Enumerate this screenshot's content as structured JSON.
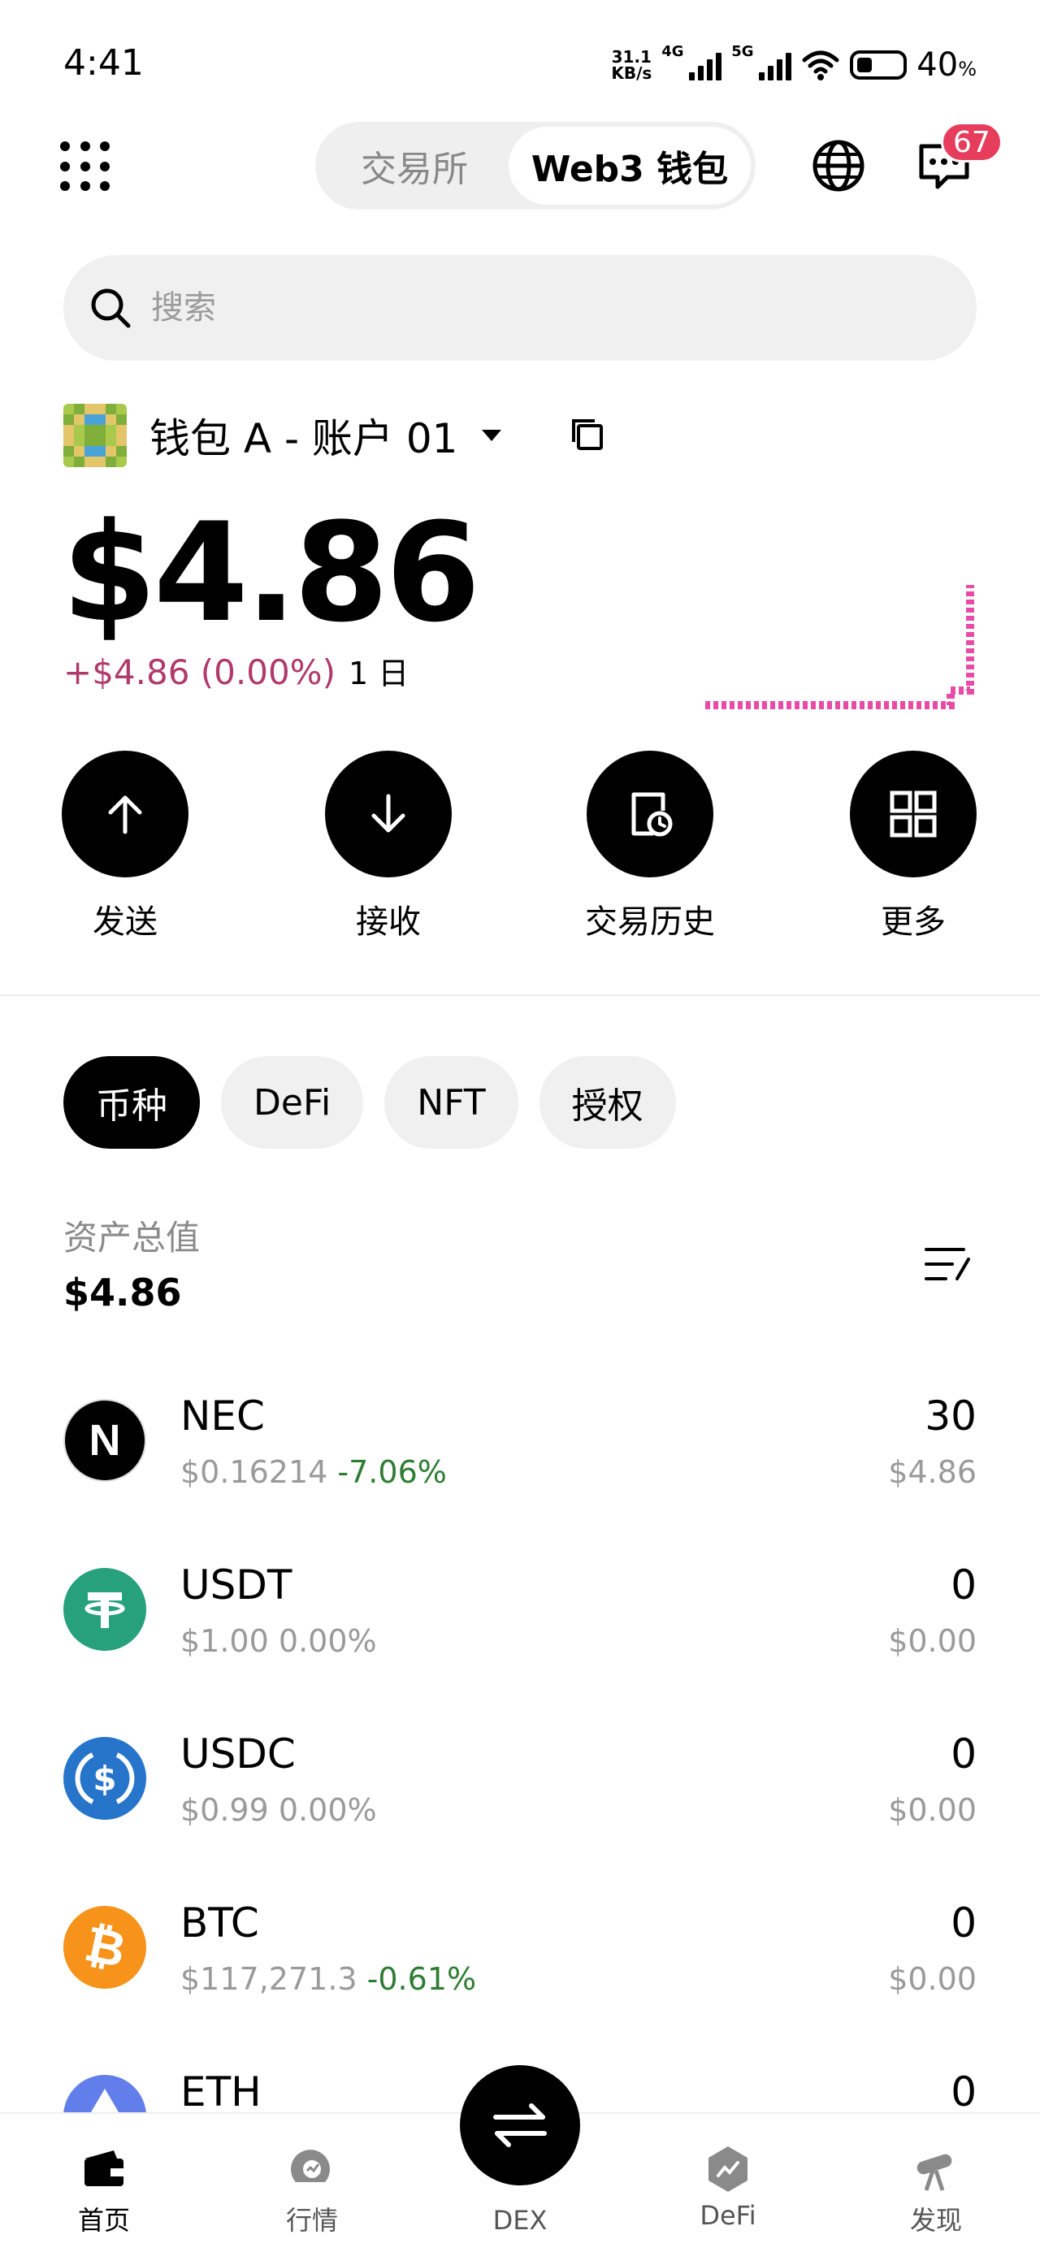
{
  "status_bar": {
    "time": "4:41",
    "net_speed_value": "31.1",
    "net_speed_unit": "KB/s",
    "signal1_label": "4G",
    "signal2_label": "5G",
    "battery_percent": "40",
    "battery_unit": "%"
  },
  "header": {
    "tabs": [
      {
        "label": "交易所",
        "active": false
      },
      {
        "label": "Web3 钱包",
        "active": true
      }
    ],
    "notification_count": "67"
  },
  "search": {
    "placeholder": "搜索"
  },
  "account": {
    "name": "钱包 A - 账户 01"
  },
  "balance": {
    "total": "$4.86",
    "change": "+$4.86 (0.00%)",
    "period": "1 日"
  },
  "actions": [
    {
      "label": "发送",
      "icon": "arrow-up-icon"
    },
    {
      "label": "接收",
      "icon": "arrow-down-icon"
    },
    {
      "label": "交易历史",
      "icon": "history-icon"
    },
    {
      "label": "更多",
      "icon": "grid-icon"
    }
  ],
  "filters": [
    {
      "label": "币种",
      "active": true
    },
    {
      "label": "DeFi",
      "active": false
    },
    {
      "label": "NFT",
      "active": false
    },
    {
      "label": "授权",
      "active": false
    }
  ],
  "assets": {
    "total_label": "资产总值",
    "total_value": "$4.86"
  },
  "tokens": [
    {
      "symbol": "NEC",
      "price": "$0.16214",
      "change": "-7.06%",
      "amount": "30",
      "value": "$4.86",
      "logo_color": "#000000"
    },
    {
      "symbol": "USDT",
      "price": "$1.00",
      "change": "0.00%",
      "amount": "0",
      "value": "$0.00",
      "logo_color": "#26a17b"
    },
    {
      "symbol": "USDC",
      "price": "$0.99",
      "change": "0.00%",
      "amount": "0",
      "value": "$0.00",
      "logo_color": "#2775ca"
    },
    {
      "symbol": "BTC",
      "price": "$117,271.3",
      "change": "-0.61%",
      "amount": "0",
      "value": "$0.00",
      "logo_color": "#f7931a"
    },
    {
      "symbol": "ETH",
      "price": "",
      "change": "",
      "amount": "0",
      "value": "",
      "logo_color": "#627eea"
    }
  ],
  "bottom_nav": [
    {
      "label": "首页",
      "active": true
    },
    {
      "label": "行情",
      "active": false
    },
    {
      "label": "DEX",
      "active": false
    },
    {
      "label": "DeFi",
      "active": false
    },
    {
      "label": "发现",
      "active": false
    }
  ],
  "colors": {
    "positive_change": "#b03a6b",
    "negative_change": "#2e7d32",
    "sparkline": "#e84aa8",
    "badge": "#e53d5b"
  }
}
